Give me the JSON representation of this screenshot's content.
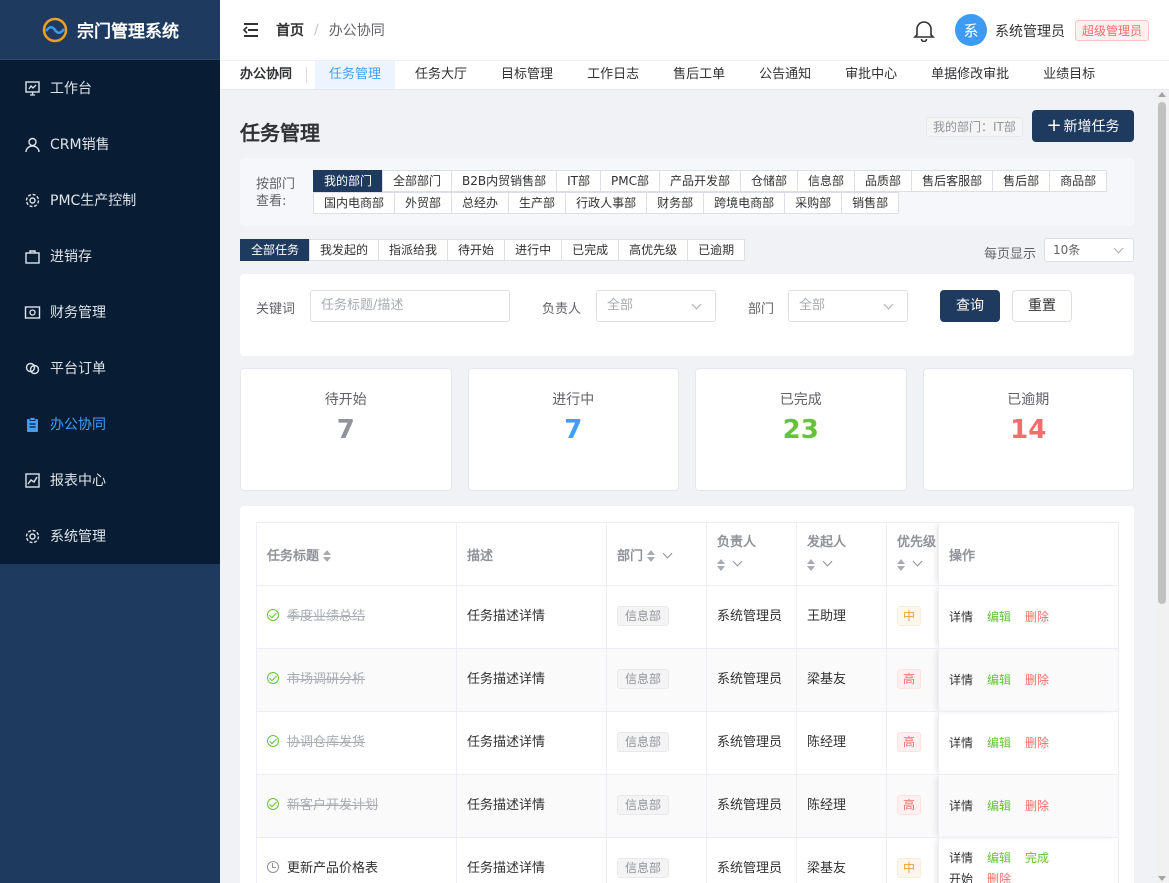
{
  "app": {
    "title": "宗门管理系统"
  },
  "sidebar": {
    "items": [
      {
        "label": "工作台",
        "icon": "workbench-icon"
      },
      {
        "label": "CRM销售",
        "icon": "user-icon"
      },
      {
        "label": "PMC生产控制",
        "icon": "gear-icon"
      },
      {
        "label": "进销存",
        "icon": "bag-icon"
      },
      {
        "label": "财务管理",
        "icon": "money-icon"
      },
      {
        "label": "平台订单",
        "icon": "link-icon"
      },
      {
        "label": "办公协同",
        "icon": "clipboard-icon",
        "active": true
      },
      {
        "label": "报表中心",
        "icon": "chart-icon"
      },
      {
        "label": "系统管理",
        "icon": "gear-icon"
      }
    ]
  },
  "header": {
    "breadcrumb": [
      "首页",
      "办公协同"
    ],
    "separator": "/",
    "avatar_text": "系",
    "user_name": "系统管理员",
    "user_role": "超级管理员"
  },
  "tabbar": {
    "group": "办公协同",
    "tabs": [
      "任务管理",
      "任务大厅",
      "目标管理",
      "工作日志",
      "售后工单",
      "公告通知",
      "审批中心",
      "单据修改审批",
      "业绩目标"
    ],
    "active": 0
  },
  "page": {
    "title": "任务管理",
    "my_dept": "我的部门：IT部",
    "add_button": "新增任务"
  },
  "dept_filter": {
    "label": "按部门查看:",
    "options": [
      "我的部门",
      "全部部门",
      "B2B内贸销售部",
      "IT部",
      "PMC部",
      "产品开发部",
      "仓储部",
      "信息部",
      "品质部",
      "售后客服部",
      "售后部",
      "商品部",
      "国内电商部",
      "外贸部",
      "总经办",
      "生产部",
      "行政人事部",
      "财务部",
      "跨境电商部",
      "采购部",
      "销售部"
    ],
    "active": 0
  },
  "status_filter": {
    "options": [
      "全部任务",
      "我发起的",
      "指派给我",
      "待开始",
      "进行中",
      "已完成",
      "高优先级",
      "已逾期"
    ],
    "active": 0
  },
  "pagination": {
    "label": "每页显示",
    "value": "10条"
  },
  "search": {
    "keyword_label": "关键词",
    "keyword_placeholder": "任务标题/描述",
    "owner_label": "负责人",
    "owner_value": "全部",
    "dept_label": "部门",
    "dept_value": "全部",
    "query_button": "查询",
    "reset_button": "重置"
  },
  "stats": [
    {
      "label": "待开始",
      "value": "7",
      "color": "#909399"
    },
    {
      "label": "进行中",
      "value": "7",
      "color": "#409eff"
    },
    {
      "label": "已完成",
      "value": "23",
      "color": "#67c23a"
    },
    {
      "label": "已逾期",
      "value": "14",
      "color": "#f56c6c"
    }
  ],
  "table": {
    "headers": {
      "title": "任务标题",
      "desc": "描述",
      "dept": "部门",
      "owner": "负责人",
      "creator": "发起人",
      "priority": "优先级",
      "ops": "操作"
    },
    "rows": [
      {
        "title": "季度业绩总结",
        "done": true,
        "desc": "任务描述详情",
        "dept": "信息部",
        "owner": "系统管理员",
        "creator": "王助理",
        "priority": "中",
        "ops": [
          "详情",
          "编辑",
          "删除"
        ]
      },
      {
        "title": "市场调研分析",
        "done": true,
        "desc": "任务描述详情",
        "dept": "信息部",
        "owner": "系统管理员",
        "creator": "梁基友",
        "priority": "高",
        "ops": [
          "详情",
          "编辑",
          "删除"
        ]
      },
      {
        "title": "协调仓库发货",
        "done": true,
        "desc": "任务描述详情",
        "dept": "信息部",
        "owner": "系统管理员",
        "creator": "陈经理",
        "priority": "高",
        "ops": [
          "详情",
          "编辑",
          "删除"
        ]
      },
      {
        "title": "新客户开发计划",
        "done": true,
        "desc": "任务描述详情",
        "dept": "信息部",
        "owner": "系统管理员",
        "creator": "陈经理",
        "priority": "高",
        "ops": [
          "详情",
          "编辑",
          "删除"
        ]
      },
      {
        "title": "更新产品价格表",
        "done": false,
        "desc": "任务描述详情",
        "dept": "信息部",
        "owner": "系统管理员",
        "creator": "梁基友",
        "priority": "中",
        "ops": [
          "详情",
          "编辑",
          "完成",
          "开始",
          "删除"
        ]
      }
    ]
  }
}
